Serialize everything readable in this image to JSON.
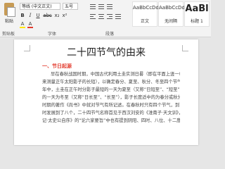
{
  "ribbon": {
    "paste_label": "粘贴",
    "font_name": "等线 (中文正文)",
    "font_size": "五号",
    "format_buttons": [
      "B",
      "I",
      "U",
      "abc",
      "x₂",
      "x²"
    ],
    "highlight_icon": "A",
    "font_color_icon": "A",
    "group_labels": {
      "clipboard": "剪贴板",
      "font": "字体",
      "paragraph": "段落"
    },
    "styles": [
      {
        "preview": "AaBbCcDd",
        "name": "正文"
      },
      {
        "preview": "AaBbCcDd",
        "name": "无间隔"
      },
      {
        "preview": "AaBl",
        "name": "标题 1"
      }
    ]
  },
  "document": {
    "title": "二十四节气的由来",
    "heading": "一、节日起源",
    "paragraphs": [
      "早在春秋战国时期，中国古代利用土圭实测日晷（即在平面上竖一根杆子",
      "来测量正午太阳影子的长短），以确定春分、夏至、秋分、冬至四个节气。一",
      "年中，土圭在正午时分影子最短的一天为夏至（又称“日短至”、“短至”），最长",
      "的一天为冬至（又称“日长至”、“长至”），影子长度适中的为春分或秋分。春秋",
      "时期的著作《尚书》中就对节气有所记述。在春秋时只有四个节气，到了周朝",
      "时发展到了八个，二十四节气名称首见于西汉刘安的《淮南子·天文训》，《史",
      "记·太史公自序》的“论六家要旨”中也有提到阴阳、四时、八位、十二度、二十"
    ]
  },
  "colors": {
    "accent_red": "#e23a2c",
    "ribbon_bg": "#f3f3f3",
    "workspace_bg": "#e6e6e6"
  }
}
